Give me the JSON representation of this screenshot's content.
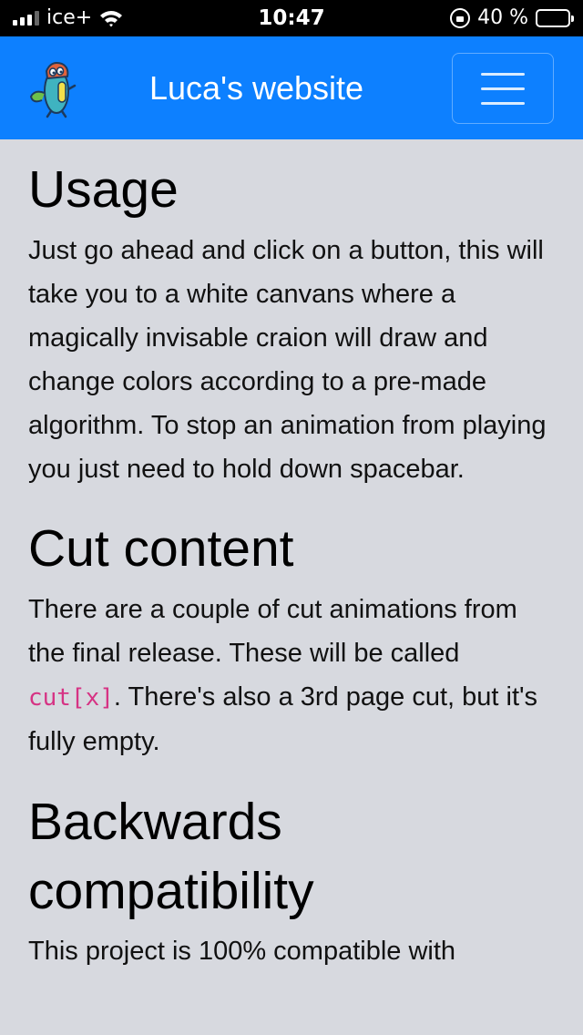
{
  "status_bar": {
    "carrier": "ice+",
    "time": "10:47",
    "battery_text": "40 %"
  },
  "navbar": {
    "title": "Luca's website"
  },
  "sections": [
    {
      "heading": "Usage",
      "paragraph": "Just go ahead and click on a button, this will take you to a white canvans where a magically invisable craion will draw and change colors according to a pre-made algorithm. To stop an animation from playing you just need to hold down spacebar."
    },
    {
      "heading": "Cut content",
      "paragraph_before": "There are a couple of cut animations from the final release. These will be called ",
      "code": "cut[x]",
      "paragraph_after": ". There's also a 3rd page cut, but it's fully empty."
    },
    {
      "heading": "Backwards compatibility",
      "paragraph": "This project is 100% compatible with"
    }
  ],
  "colors": {
    "navbar_bg": "#0d80ff",
    "page_bg": "#d7d9df",
    "code": "#d63384"
  }
}
